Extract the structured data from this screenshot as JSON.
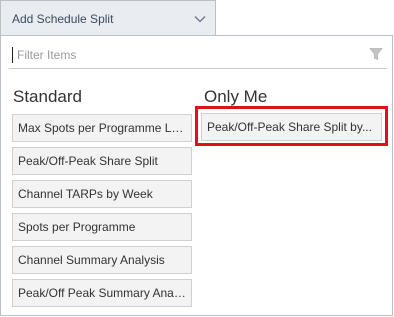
{
  "dropdown": {
    "label": "Add Schedule Split",
    "icon": "chevron-down-icon"
  },
  "filter": {
    "placeholder": "Filter Items",
    "icon": "funnel-icon"
  },
  "columns": {
    "standard": {
      "title": "Standard",
      "items": [
        "Max Spots per Programme Le...",
        "Peak/Off-Peak Share Split",
        "Channel TARPs by Week",
        "Spots per Programme",
        "Channel Summary Analysis",
        "Peak/Off Peak Summary Anal..."
      ]
    },
    "only_me": {
      "title": "Only Me",
      "items": [
        "Peak/Off-Peak Share Split by..."
      ]
    }
  },
  "colors": {
    "highlight": "#e0111b",
    "button_bg": "#e9ecf1",
    "item_bg": "#f3f3f3"
  }
}
